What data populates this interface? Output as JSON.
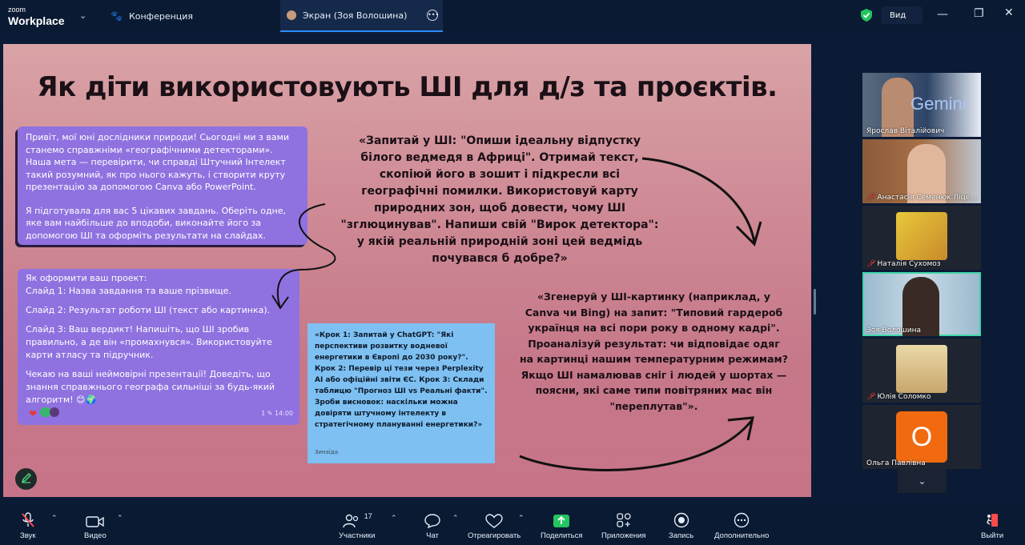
{
  "app": {
    "brand_top": "zoom",
    "brand_bottom": "Workplace"
  },
  "tabs": [
    {
      "label": "Конференция",
      "icon": "paw-icon"
    },
    {
      "label": "Экран (Зоя Волошина)",
      "icon": "avatar-icon"
    }
  ],
  "header": {
    "view_label": "Вид"
  },
  "slide": {
    "title": "Як діти використовують ШІ для д/з та проєктів.",
    "chat1": [
      "Привіт, мої юні дослідники природи! Сьогодні ми з вами станемо справжніми «географічними детекторами». Наша мета — перевірити, чи справді Штучний Інтелект такий розумний, як про нього кажуть, і створити круту презентацію за допомогою Canva або PowerPoint.",
      "Я підготувала для вас 5 цікавих завдань. Оберіть одне, яке вам найбільше до вподоби, виконайте його за допомогою ШІ та оформіть результати на слайдах."
    ],
    "chat2": [
      "Як оформити ваш проект:\nСлайд 1: Назва завдання та ваше прізвище.",
      "Слайд 2: Результат роботи ШІ (текст або картинка).",
      "Слайд 3: Ваш вердикт! Напишіть, що ШІ зробив правильно, а де він «промахнувся». Використовуйте карти атласу та підручник.",
      "Чекаю на ваші неймовірні презентації! Доведіть, що знання справжнього географа сильніші за будь-який алгоритм! 😊🌍"
    ],
    "chat2_meta": "1 ✎ 14:00",
    "quote1": "«Запитай у ШІ: \"Опиши ідеальну відпустку білого ведмедя в Африці\". Отримай текст, скопіюй його в зошит і підкресли всі географічні помилки. Використовуй карту природних зон, щоб довести, чому ШІ \"зглюцинував\". Напиши свій \"Вирок детектора\": у якій реальній природній зоні цей ведмідь почувався б добре?»",
    "quote2": "«Згенеруй у ШІ-картинку (наприклад, у Canva чи Bing) на запит: \"Типовий гардероб українця на всі пори року в одному кадрі\". Проаналізуй результат: чи відповідає одяг на картинці нашим температурним режимам? Якщо ШІ намалював сніг і людей у шортах — поясни, які саме типи повітряних мас він \"переплутав\"».",
    "note": "«Крок 1: Запитай у ChatGPT: \"Які перспективи розвитку водневої енергетики в Європі до 2030 року?\". Крок 2: Перевір ці тези через Perplexity AI або офіційні звіти ЄС. Крок 3: Склади таблицю \"Прогноз ШІ vs Реальні факти\". Зроби висновок: наскільки можна довіряти штучному інтелекту в стратегічному плануванні енергетики?»",
    "note_author": "Зинаїда"
  },
  "participants": [
    {
      "name": "Ярослав Віталійович",
      "muted": false,
      "bg": "#3b4f6b",
      "overlay": "Gemini"
    },
    {
      "name": "Анастасія Семенюк Ліце...",
      "muted": true,
      "bg": "#7a5a3c",
      "overlay": ""
    },
    {
      "name": "Наталія Сухомоз",
      "muted": true,
      "bg": "#1f2530",
      "overlay": ""
    },
    {
      "name": "Зоя Волошина",
      "muted": false,
      "bg": "#8fb6cf",
      "overlay": ""
    },
    {
      "name": "Юлія Соломко",
      "muted": true,
      "bg": "#1f2530",
      "overlay": ""
    },
    {
      "name": "Ольга Павлівна",
      "muted": false,
      "bg": "#1f2530",
      "overlay": "О"
    }
  ],
  "toolbar": {
    "audio": "Звук",
    "video": "Видео",
    "participants": "Участники",
    "participants_count": "17",
    "chat": "Чат",
    "react": "Отреагировать",
    "share": "Поделиться",
    "apps": "Приложения",
    "record": "Запись",
    "more": "Дополнительно",
    "leave": "Выйти"
  },
  "colors": {
    "accent": "#2d8cff",
    "active_speaker": "#3fd6a6",
    "share_green": "#23c55e",
    "danger": "#ff4b4b"
  }
}
